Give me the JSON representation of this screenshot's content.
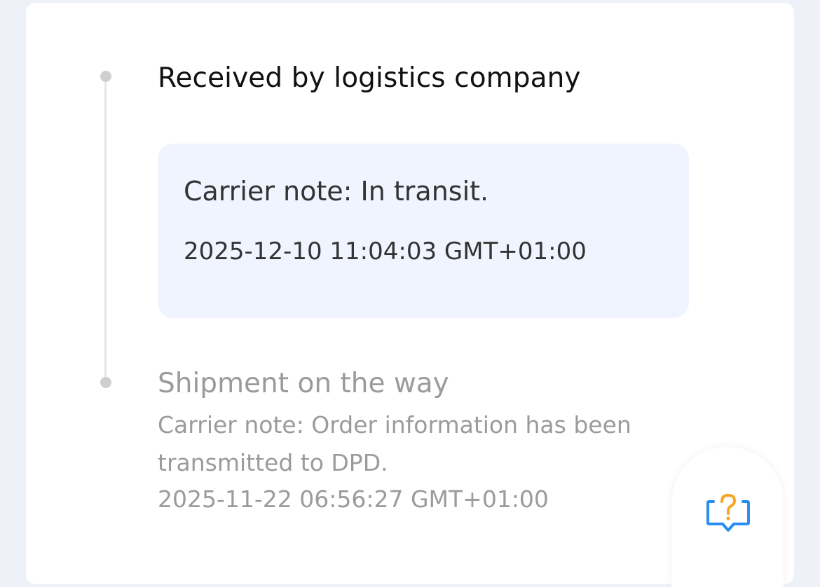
{
  "timeline": {
    "steps": [
      {
        "title": "Received by logistics company",
        "note": "Carrier note: In transit.",
        "time": "2025-12-10 11:04:03 GMT+01:00",
        "active": true
      },
      {
        "title": "Shipment on the way",
        "note": "Carrier note: Order information has been transmitted to DPD.",
        "time": "2025-11-22 06:56:27 GMT+01:00",
        "active": false
      }
    ]
  },
  "help_button": {
    "icon": "help-chat-icon",
    "colors": {
      "outline": "#2a8ef0",
      "question_mark": "#f5a623"
    }
  }
}
